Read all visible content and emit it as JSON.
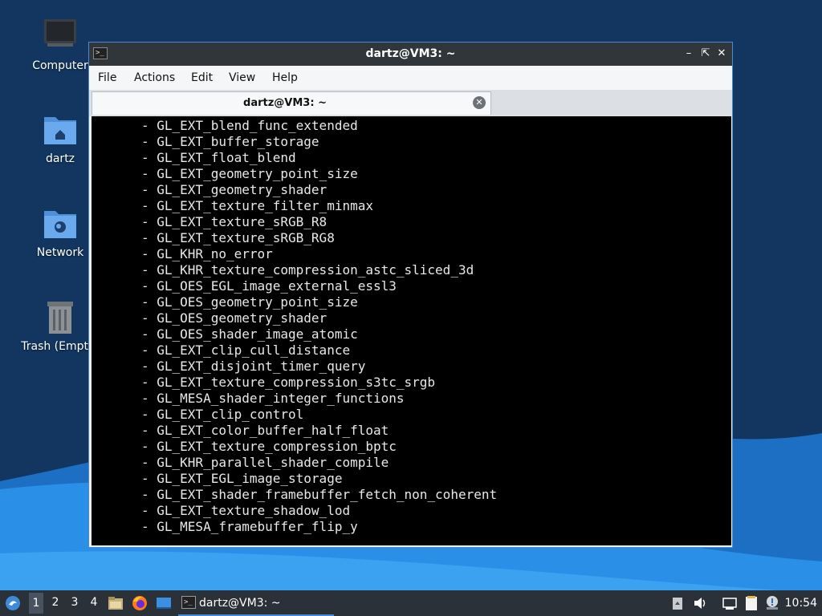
{
  "desktop": {
    "icons": [
      {
        "label": "Computer"
      },
      {
        "label": "dartz"
      },
      {
        "label": "Network"
      },
      {
        "label": "Trash (Empty)"
      }
    ]
  },
  "window": {
    "title": "dartz@VM3: ~",
    "menu": [
      "File",
      "Actions",
      "Edit",
      "View",
      "Help"
    ],
    "tab_label": "dartz@VM3: ~"
  },
  "terminal": {
    "lines": [
      "- GL_EXT_blend_func_extended",
      "- GL_EXT_buffer_storage",
      "- GL_EXT_float_blend",
      "- GL_EXT_geometry_point_size",
      "- GL_EXT_geometry_shader",
      "- GL_EXT_texture_filter_minmax",
      "- GL_EXT_texture_sRGB_R8",
      "- GL_EXT_texture_sRGB_RG8",
      "- GL_KHR_no_error",
      "- GL_KHR_texture_compression_astc_sliced_3d",
      "- GL_OES_EGL_image_external_essl3",
      "- GL_OES_geometry_point_size",
      "- GL_OES_geometry_shader",
      "- GL_OES_shader_image_atomic",
      "- GL_EXT_clip_cull_distance",
      "- GL_EXT_disjoint_timer_query",
      "- GL_EXT_texture_compression_s3tc_srgb",
      "- GL_MESA_shader_integer_functions",
      "- GL_EXT_clip_control",
      "- GL_EXT_color_buffer_half_float",
      "- GL_EXT_texture_compression_bptc",
      "- GL_KHR_parallel_shader_compile",
      "- GL_EXT_EGL_image_storage",
      "- GL_EXT_shader_framebuffer_fetch_non_coherent",
      "- GL_EXT_texture_shadow_lod",
      "- GL_MESA_framebuffer_flip_y"
    ]
  },
  "taskbar": {
    "workspaces": [
      "1",
      "2",
      "3",
      "4"
    ],
    "active_workspace": "1",
    "task_label": "dartz@VM3: ~",
    "clock": "10:54"
  },
  "colors": {
    "accent": "#4a8ad4",
    "titlebar": "#31363b",
    "terminal_bg": "#000000"
  }
}
